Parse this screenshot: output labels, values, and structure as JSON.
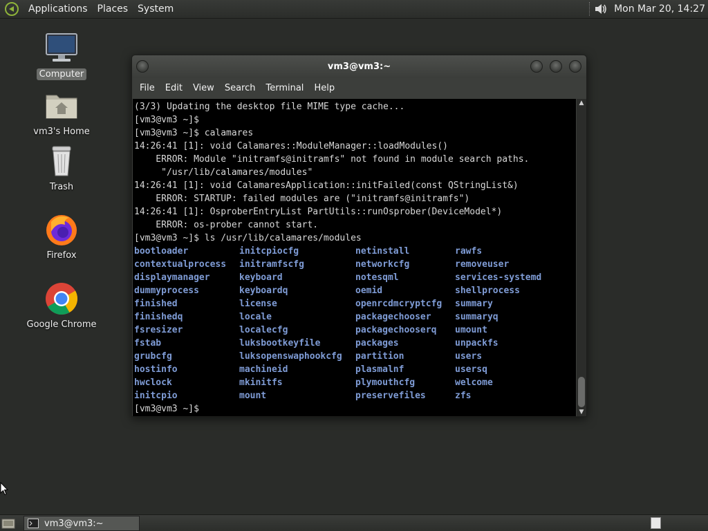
{
  "top_panel": {
    "menus": [
      "Applications",
      "Places",
      "System"
    ],
    "clock": "Mon Mar 20, 14:27",
    "icons": [
      "distro-logo-icon",
      "volume-icon"
    ]
  },
  "desktop": {
    "icons": [
      {
        "label": "Computer",
        "icon": "computer-icon",
        "selected": true
      },
      {
        "label": "vm3's Home",
        "icon": "home-folder-icon"
      },
      {
        "label": "Trash",
        "icon": "trash-icon"
      },
      {
        "label": "Firefox",
        "icon": "firefox-icon"
      },
      {
        "label": "Google Chrome",
        "icon": "chrome-icon"
      }
    ]
  },
  "terminal": {
    "title": "vm3@vm3:~",
    "menu": [
      "File",
      "Edit",
      "View",
      "Search",
      "Terminal",
      "Help"
    ],
    "lines": [
      "(3/3) Updating the desktop file MIME type cache...",
      "[vm3@vm3 ~]$",
      "[vm3@vm3 ~]$ calamares",
      "14:26:41 [1]: void Calamares::ModuleManager::loadModules()",
      "    ERROR: Module \"initramfs@initramfs\" not found in module search paths.",
      "     \"/usr/lib/calamares/modules\"",
      "14:26:41 [1]: void CalamaresApplication::initFailed(const QStringList&)",
      "    ERROR: STARTUP: failed modules are (\"initramfs@initramfs\")",
      "14:26:41 [1]: OsproberEntryList PartUtils::runOsprober(DeviceModel*)",
      "    ERROR: os-prober cannot start.",
      "[vm3@vm3 ~]$ ls /usr/lib/calamares/modules"
    ],
    "ls_rows": [
      [
        "bootloader",
        "initcpiocfg",
        "netinstall",
        "rawfs"
      ],
      [
        "contextualprocess",
        "initramfscfg",
        "networkcfg",
        "removeuser"
      ],
      [
        "displaymanager",
        "keyboard",
        "notesqml",
        "services-systemd"
      ],
      [
        "dummyprocess",
        "keyboardq",
        "oemid",
        "shellprocess"
      ],
      [
        "finished",
        "license",
        "openrcdmcryptcfg",
        "summary"
      ],
      [
        "finishedq",
        "locale",
        "packagechooser",
        "summaryq"
      ],
      [
        "fsresizer",
        "localecfg",
        "packagechooserq",
        "umount"
      ],
      [
        "fstab",
        "luksbootkeyfile",
        "packages",
        "unpackfs"
      ],
      [
        "grubcfg",
        "luksopenswaphookcfg",
        "partition",
        "users"
      ],
      [
        "hostinfo",
        "machineid",
        "plasmalnf",
        "usersq"
      ],
      [
        "hwclock",
        "mkinitfs",
        "plymouthcfg",
        "welcome"
      ],
      [
        "initcpio",
        "mount",
        "preservefiles",
        "zfs"
      ]
    ],
    "prompt": "[vm3@vm3 ~]$",
    "ls_color": "#7f9cd6"
  },
  "bottom_panel": {
    "task_label": "vm3@vm3:~"
  }
}
